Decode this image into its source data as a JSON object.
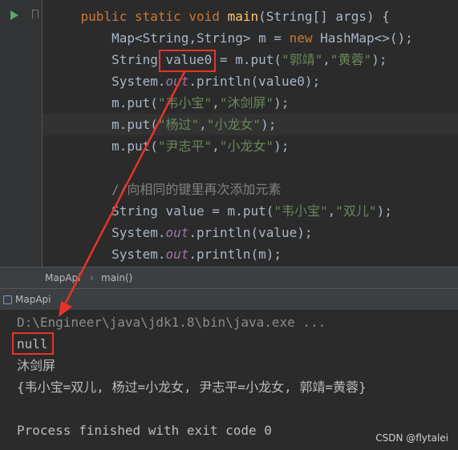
{
  "editor": {
    "lines": [
      {
        "indent": "    ",
        "parts": [
          [
            "kw",
            "public static void "
          ],
          [
            "fn",
            "main"
          ],
          [
            "p",
            "(String[] args) {"
          ]
        ]
      },
      {
        "indent": "        ",
        "parts": [
          [
            "p",
            "Map<String,String> m = "
          ],
          [
            "kw",
            "new "
          ],
          [
            "p",
            "HashMap<>();"
          ]
        ]
      },
      {
        "indent": "        ",
        "parts": [
          [
            "p",
            "String value0 = m.put("
          ],
          [
            "str",
            "\"郭靖\""
          ],
          [
            "p",
            ","
          ],
          [
            "str",
            "\"黄蓉\""
          ],
          [
            "p",
            ");"
          ]
        ]
      },
      {
        "indent": "        ",
        "parts": [
          [
            "p",
            "System."
          ],
          [
            "fld",
            "out"
          ],
          [
            "p",
            ".println(value0);"
          ]
        ]
      },
      {
        "indent": "        ",
        "parts": [
          [
            "p",
            "m.put("
          ],
          [
            "str",
            "\"韦小宝\""
          ],
          [
            "p",
            ","
          ],
          [
            "str",
            "\"沐剑屏\""
          ],
          [
            "p",
            ");"
          ]
        ]
      },
      {
        "indent": "        ",
        "parts": [
          [
            "p",
            "m.put("
          ],
          [
            "str",
            "\"杨过\""
          ],
          [
            "p",
            ","
          ],
          [
            "str",
            "\"小龙女\""
          ],
          [
            "p",
            ");"
          ]
        ]
      },
      {
        "indent": "        ",
        "parts": [
          [
            "p",
            "m.put("
          ],
          [
            "str",
            "\"尹志平\""
          ],
          [
            "p",
            ","
          ],
          [
            "str",
            "\"小龙女\""
          ],
          [
            "p",
            ");"
          ]
        ]
      },
      {
        "indent": "",
        "parts": []
      },
      {
        "indent": "        ",
        "parts": [
          [
            "cmt",
            "//向相同的键里再次添加元素"
          ]
        ]
      },
      {
        "indent": "        ",
        "parts": [
          [
            "p",
            "String value = m.put("
          ],
          [
            "str",
            "\"韦小宝\""
          ],
          [
            "p",
            ","
          ],
          [
            "str",
            "\"双儿\""
          ],
          [
            "p",
            ");"
          ]
        ]
      },
      {
        "indent": "        ",
        "parts": [
          [
            "p",
            "System."
          ],
          [
            "fld",
            "out"
          ],
          [
            "p",
            ".println(value);"
          ]
        ]
      },
      {
        "indent": "        ",
        "parts": [
          [
            "p",
            "System."
          ],
          [
            "fld",
            "out"
          ],
          [
            "p",
            ".println(m);"
          ]
        ]
      }
    ]
  },
  "breadcrumb": {
    "class_name": "MapApi",
    "separator": "›",
    "method": "main()"
  },
  "run_panel": {
    "tab_label": "MapApi"
  },
  "console": {
    "lines": [
      "D:\\Engineer\\java\\jdk1.8\\bin\\java.exe ...",
      "null",
      "沐剑屏",
      "{韦小宝=双儿, 杨过=小龙女, 尹志平=小龙女, 郭靖=黄蓉}",
      "",
      "Process finished with exit code 0"
    ]
  },
  "watermark": "CSDN @flytalei",
  "colors": {
    "keyword": "#cc7832",
    "method": "#ffc66d",
    "string": "#6a8759",
    "field": "#9876aa",
    "comment": "#808080",
    "annotation": "#e8332a"
  }
}
